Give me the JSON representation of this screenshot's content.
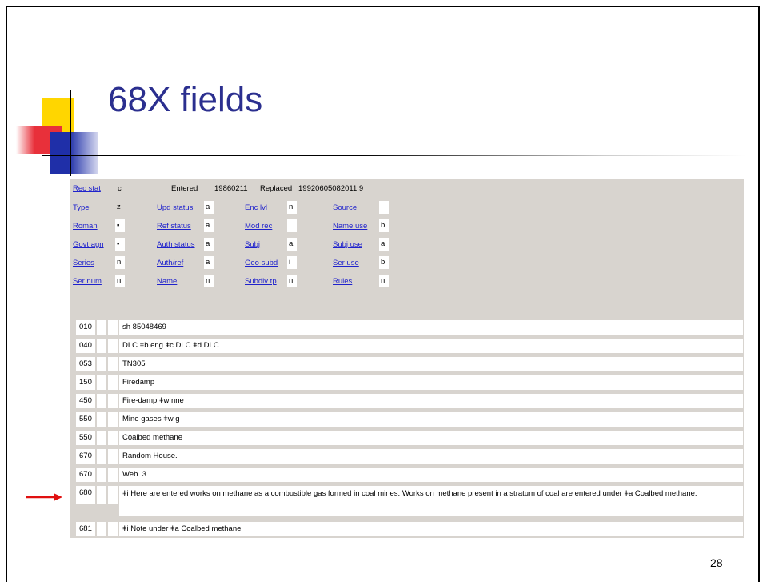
{
  "slide": {
    "title": "68X fields",
    "page_number": "28"
  },
  "record": {
    "top": {
      "rec_stat_label": "Rec stat",
      "rec_stat_value": "c",
      "entered_label": "Entered",
      "entered_value": "19860211",
      "replaced_label": "Replaced",
      "replaced_value": "19920605082011.9"
    },
    "fixed_fields": [
      [
        {
          "label": "Type",
          "value": "z"
        },
        {
          "label": "Upd status",
          "value": "a"
        },
        {
          "label": "Enc lvl",
          "value": "n"
        },
        {
          "label": "Source",
          "value": ""
        }
      ],
      [
        {
          "label": "Roman",
          "value": "▪"
        },
        {
          "label": "Ref status",
          "value": "a"
        },
        {
          "label": "Mod rec",
          "value": ""
        },
        {
          "label": "Name use",
          "value": "b"
        }
      ],
      [
        {
          "label": "Govt agn",
          "value": "▪"
        },
        {
          "label": "Auth status",
          "value": "a"
        },
        {
          "label": "Subj",
          "value": "a"
        },
        {
          "label": "Subj use",
          "value": "a"
        }
      ],
      [
        {
          "label": "Series",
          "value": "n"
        },
        {
          "label": "Auth/ref",
          "value": "a"
        },
        {
          "label": "Geo subd",
          "value": "i"
        },
        {
          "label": "Ser use",
          "value": "b"
        }
      ],
      [
        {
          "label": "Ser num",
          "value": "n"
        },
        {
          "label": "Name",
          "value": "n"
        },
        {
          "label": "Subdiv tp",
          "value": "n"
        },
        {
          "label": "Rules",
          "value": "n"
        }
      ]
    ],
    "variable_fields": [
      {
        "tag": "010",
        "data": "sh 85048469"
      },
      {
        "tag": "040",
        "data": "DLC ǂb eng ǂc DLC ǂd DLC"
      },
      {
        "tag": "053",
        "data": "TN305"
      },
      {
        "tag": "150",
        "data": "Firedamp"
      },
      {
        "tag": "450",
        "data": "Fire-damp ǂw nne"
      },
      {
        "tag": "550",
        "data": "Mine gases ǂw g"
      },
      {
        "tag": "550",
        "data": "Coalbed methane"
      },
      {
        "tag": "670",
        "data": "Random House."
      },
      {
        "tag": "670",
        "data": "Web. 3."
      },
      {
        "tag": "680",
        "data": "ǂi Here are entered works on methane as a combustible gas formed in coal mines. Works on methane present in a stratum of coal are entered under ǂa Coalbed methane."
      },
      {
        "tag": "681",
        "data": "ǂi Note under ǂa Coalbed methane"
      }
    ]
  },
  "colors": {
    "title": "#2b2f8f",
    "link": "#1f22cc",
    "panel_bg": "#d8d4cf",
    "arrow": "#e01010"
  }
}
